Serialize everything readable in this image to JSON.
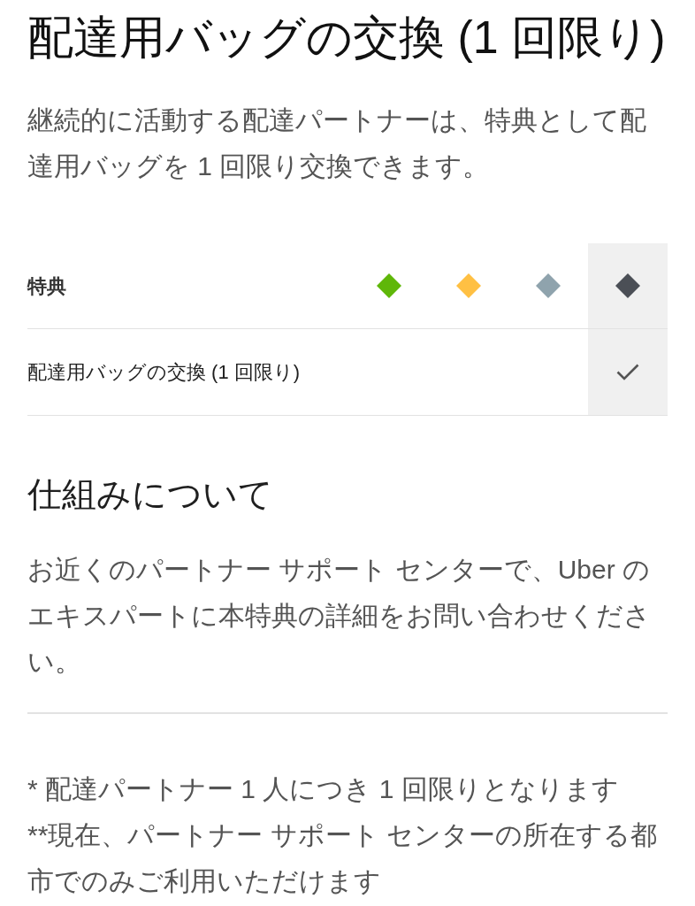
{
  "title": "配達用バッグの交換 (1 回限り)",
  "intro": "継続的に活動する配達パートナーは、特典として配達用バッグを 1 回限り交換できます。",
  "benefits_table": {
    "header_label": "特典",
    "tiers": [
      {
        "color": "#5fb709",
        "selected": false
      },
      {
        "color": "#ffc043",
        "selected": false
      },
      {
        "color": "#8fa3ad",
        "selected": false
      },
      {
        "color": "#4b4f56",
        "selected": true
      }
    ],
    "rows": [
      {
        "label": "配達用バッグの交換 (1 回限り)",
        "cells": [
          {
            "checked": false
          },
          {
            "checked": false
          },
          {
            "checked": false
          },
          {
            "checked": true
          }
        ]
      }
    ]
  },
  "how_it_works": {
    "heading": "仕組みについて",
    "body": "お近くのパートナー サポート センターで、Uber のエキスパートに本特典の詳細をお問い合わせください。"
  },
  "footnotes": [
    "* 配達パートナー 1 人につき 1 回限りとなります",
    "**現在、パートナー サポート センターの所在する都市でのみご利用いただけます"
  ]
}
